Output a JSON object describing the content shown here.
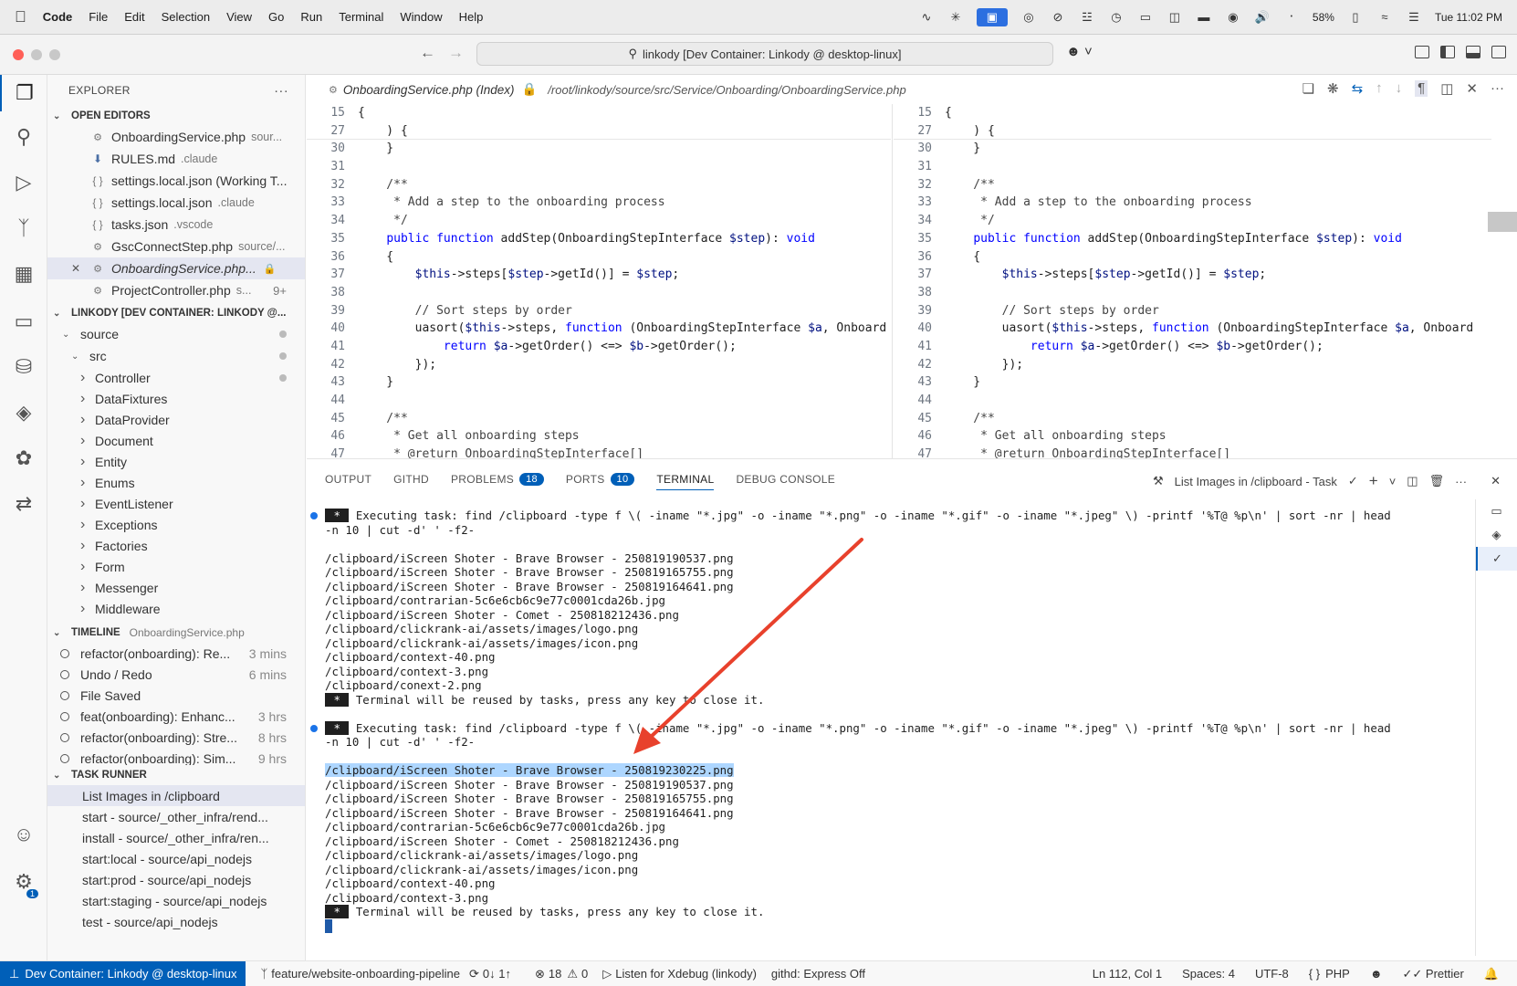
{
  "menubar": {
    "app": "Code",
    "items": [
      "File",
      "Edit",
      "Selection",
      "View",
      "Go",
      "Run",
      "Terminal",
      "Window",
      "Help"
    ],
    "battery": "58%",
    "clock": "Tue 11:02 PM"
  },
  "titlebar": {
    "command_center": "linkody [Dev Container: Linkody @ desktop-linux]"
  },
  "sidebar": {
    "title": "EXPLORER",
    "open_editors_label": "OPEN EDITORS",
    "open_editors": [
      {
        "name": "OnboardingService.php",
        "hint": "sour...",
        "icon": "php"
      },
      {
        "name": "RULES.md",
        "hint": ".claude",
        "icon": "md"
      },
      {
        "name": "settings.local.json (Working T...",
        "hint": "",
        "icon": "json"
      },
      {
        "name": "settings.local.json",
        "hint": ".claude",
        "icon": "json"
      },
      {
        "name": "tasks.json",
        "hint": ".vscode",
        "icon": "json"
      },
      {
        "name": "GscConnectStep.php",
        "hint": "source/...",
        "icon": "php"
      },
      {
        "name": "OnboardingService.php...",
        "hint": "",
        "icon": "php",
        "active": true
      },
      {
        "name": "ProjectController.php",
        "hint": "s...",
        "icon": "php",
        "badge": "9+"
      }
    ],
    "workspace_label": "LINKODY [DEV CONTAINER: LINKODY @...",
    "tree_root": [
      "source",
      "src"
    ],
    "folders": [
      "Controller",
      "DataFixtures",
      "DataProvider",
      "Document",
      "Entity",
      "Enums",
      "EventListener",
      "Exceptions",
      "Factories",
      "Form",
      "Messenger",
      "Middleware"
    ],
    "timeline_label": "TIMELINE",
    "timeline_file": "OnboardingService.php",
    "timeline": [
      {
        "label": "refactor(onboarding): Re...",
        "time": "3 mins"
      },
      {
        "label": "Undo / Redo",
        "time": "6 mins"
      },
      {
        "label": "File Saved",
        "time": ""
      },
      {
        "label": "feat(onboarding): Enhanc...",
        "time": "3 hrs"
      },
      {
        "label": "refactor(onboarding): Stre...",
        "time": "8 hrs"
      },
      {
        "label": "refactor(onboarding): Sim...",
        "time": "9 hrs"
      }
    ],
    "task_runner_label": "TASK RUNNER",
    "tasks": [
      "List Images in /clipboard",
      "start - source/_other_infra/rend...",
      "install - source/_other_infra/ren...",
      "start:local - source/api_nodejs",
      "start:prod - source/api_nodejs",
      "start:staging - source/api_nodejs",
      "test - source/api_nodejs"
    ]
  },
  "editor": {
    "title": "OnboardingService.php (Index)",
    "path": "/root/linkody/source/src/Service/Onboarding/OnboardingService.php",
    "lines": [
      {
        "n": "15",
        "t": "{"
      },
      {
        "n": "27",
        "t": "    ) {"
      },
      {
        "n": "30",
        "t": "    }"
      },
      {
        "n": "31",
        "t": ""
      },
      {
        "n": "32",
        "t": "    /**"
      },
      {
        "n": "33",
        "t": "     * Add a step to the onboarding process"
      },
      {
        "n": "34",
        "t": "     */"
      },
      {
        "n": "35",
        "t": "    public function addStep(OnboardingStepInterface $step): void"
      },
      {
        "n": "36",
        "t": "    {"
      },
      {
        "n": "37",
        "t": "        $this->steps[$step->getId()] = $step;"
      },
      {
        "n": "38",
        "t": ""
      },
      {
        "n": "39",
        "t": "        // Sort steps by order"
      },
      {
        "n": "40",
        "t": "        uasort($this->steps, function (OnboardingStepInterface $a, Onboard"
      },
      {
        "n": "41",
        "t": "            return $a->getOrder() <=> $b->getOrder();"
      },
      {
        "n": "42",
        "t": "        });"
      },
      {
        "n": "43",
        "t": "    }"
      },
      {
        "n": "44",
        "t": ""
      },
      {
        "n": "45",
        "t": "    /**"
      },
      {
        "n": "46",
        "t": "     * Get all onboarding steps"
      },
      {
        "n": "47",
        "t": "     * @return OnboardingStepInterface[]"
      }
    ]
  },
  "panel": {
    "tabs": [
      {
        "label": "OUTPUT"
      },
      {
        "label": "GITHD"
      },
      {
        "label": "PROBLEMS",
        "badge": "18"
      },
      {
        "label": "PORTS",
        "badge": "10"
      },
      {
        "label": "TERMINAL",
        "active": true
      },
      {
        "label": "DEBUG CONSOLE"
      }
    ],
    "task_name": "List Images in /clipboard - Task",
    "terminal": [
      {
        "type": "exec",
        "text": " Executing task: find /clipboard -type f \\( -iname \"*.jpg\" -o -iname \"*.png\" -o -iname \"*.gif\" -o -iname \"*.jpeg\" \\) -printf '%T@ %p\\n' | sort -nr | head"
      },
      {
        "type": "cont",
        "text": "-n 10 | cut -d' ' -f2-"
      },
      {
        "type": "blank",
        "text": ""
      },
      {
        "type": "out",
        "text": "/clipboard/iScreen Shoter - Brave Browser - 250819190537.png"
      },
      {
        "type": "out",
        "text": "/clipboard/iScreen Shoter - Brave Browser - 250819165755.png"
      },
      {
        "type": "out",
        "text": "/clipboard/iScreen Shoter - Brave Browser - 250819164641.png"
      },
      {
        "type": "out",
        "text": "/clipboard/contrarian-5c6e6cb6c9e77c0001cda26b.jpg"
      },
      {
        "type": "out",
        "text": "/clipboard/iScreen Shoter - Comet - 250818212436.png"
      },
      {
        "type": "out",
        "text": "/clipboard/clickrank-ai/assets/images/logo.png"
      },
      {
        "type": "out",
        "text": "/clipboard/clickrank-ai/assets/images/icon.png"
      },
      {
        "type": "out",
        "text": "/clipboard/context-40.png"
      },
      {
        "type": "out",
        "text": "/clipboard/context-3.png"
      },
      {
        "type": "out",
        "text": "/clipboard/conext-2.png"
      },
      {
        "type": "reuse",
        "text": " Terminal will be reused by tasks, press any key to close it."
      },
      {
        "type": "blank",
        "text": ""
      },
      {
        "type": "exec",
        "text": " Executing task: find /clipboard -type f \\( -iname \"*.jpg\" -o -iname \"*.png\" -o -iname \"*.gif\" -o -iname \"*.jpeg\" \\) -printf '%T@ %p\\n' | sort -nr | head"
      },
      {
        "type": "cont",
        "text": "-n 10 | cut -d' ' -f2-"
      },
      {
        "type": "blank",
        "text": ""
      },
      {
        "type": "hl",
        "text": "/clipboard/iScreen Shoter - Brave Browser - 250819230225.png"
      },
      {
        "type": "out",
        "text": "/clipboard/iScreen Shoter - Brave Browser - 250819190537.png"
      },
      {
        "type": "out",
        "text": "/clipboard/iScreen Shoter - Brave Browser - 250819165755.png"
      },
      {
        "type": "out",
        "text": "/clipboard/iScreen Shoter - Brave Browser - 250819164641.png"
      },
      {
        "type": "out",
        "text": "/clipboard/contrarian-5c6e6cb6c9e77c0001cda26b.jpg"
      },
      {
        "type": "out",
        "text": "/clipboard/iScreen Shoter - Comet - 250818212436.png"
      },
      {
        "type": "out",
        "text": "/clipboard/clickrank-ai/assets/images/logo.png"
      },
      {
        "type": "out",
        "text": "/clipboard/clickrank-ai/assets/images/icon.png"
      },
      {
        "type": "out",
        "text": "/clipboard/context-40.png"
      },
      {
        "type": "out",
        "text": "/clipboard/context-3.png"
      },
      {
        "type": "reuse",
        "text": " Terminal will be reused by tasks, press any key to close it."
      }
    ]
  },
  "statusbar": {
    "remote": "Dev Container: Linkody @ desktop-linux",
    "branch": "feature/website-onboarding-pipeline",
    "sync": "0↓ 1↑",
    "errors": "18",
    "warnings": "0",
    "xdebug": "Listen for Xdebug (linkody)",
    "githd": "githd: Express Off",
    "position": "Ln 112, Col 1",
    "spaces": "Spaces: 4",
    "encoding": "UTF-8",
    "language": "PHP",
    "prettier": "Prettier"
  },
  "colors": {
    "accent": "#005fb8",
    "arrow": "#e8412c",
    "selection": "#add6ff"
  }
}
